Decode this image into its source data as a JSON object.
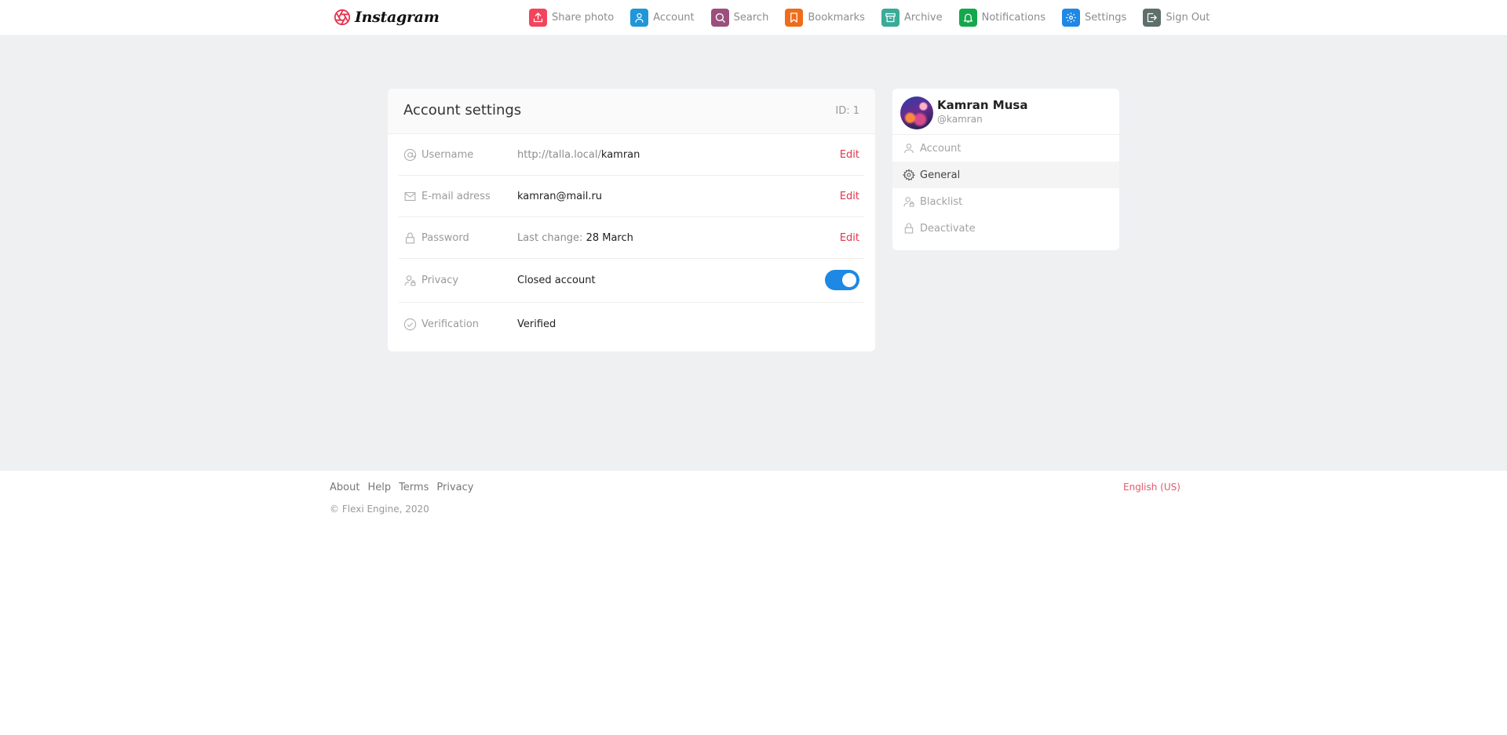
{
  "brand": {
    "name": "Instagram"
  },
  "nav": [
    {
      "label": "Share photo",
      "icon": "upload-icon",
      "color": "#f2455c"
    },
    {
      "label": "Account",
      "icon": "user-icon",
      "color": "#2196d9"
    },
    {
      "label": "Search",
      "icon": "search-icon",
      "color": "#9b4f7d"
    },
    {
      "label": "Bookmarks",
      "icon": "bookmark-icon",
      "color": "#ef6c1a"
    },
    {
      "label": "Archive",
      "icon": "archive-icon",
      "color": "#3aab98"
    },
    {
      "label": "Notifications",
      "icon": "bell-icon",
      "color": "#15a84a"
    },
    {
      "label": "Settings",
      "icon": "gear-icon",
      "color": "#1e88e5"
    },
    {
      "label": "Sign Out",
      "icon": "sign-out-icon",
      "color": "#5f6f6b"
    }
  ],
  "settings": {
    "title": "Account settings",
    "id_label": "ID: 1",
    "rows": {
      "username": {
        "label": "Username",
        "prefix": "http://talla.local/",
        "value": "kamran",
        "action": "Edit"
      },
      "email": {
        "label": "E-mail adress",
        "value": "kamran@mail.ru",
        "action": "Edit"
      },
      "password": {
        "label": "Password",
        "prefix": "Last change: ",
        "value": "28 March",
        "action": "Edit"
      },
      "privacy": {
        "label": "Privacy",
        "value": "Closed account",
        "toggle_on": true
      },
      "verification": {
        "label": "Verification",
        "value": "Verified"
      }
    }
  },
  "sidebar": {
    "name": "Kamran Musa",
    "handle": "@kamran",
    "items": [
      {
        "label": "Account",
        "icon": "user-icon",
        "active": false
      },
      {
        "label": "General",
        "icon": "gear-icon",
        "active": true
      },
      {
        "label": "Blacklist",
        "icon": "user-lock-icon",
        "active": false
      },
      {
        "label": "Deactivate",
        "icon": "lock-icon",
        "active": false
      }
    ]
  },
  "footer": {
    "links": [
      "About",
      "Help",
      "Terms",
      "Privacy"
    ],
    "copyright": "© Flexi Engine, 2020",
    "language": "English (US)"
  },
  "colors": {
    "accent_red": "#e0344d",
    "toggle_blue": "#1e88e5"
  }
}
